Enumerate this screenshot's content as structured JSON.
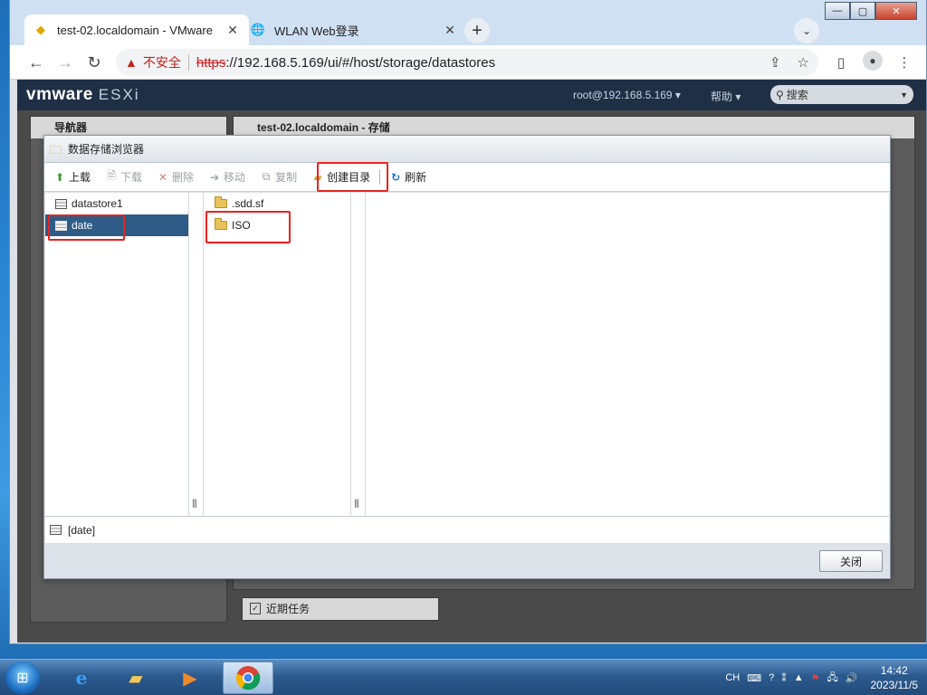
{
  "browser": {
    "tabs": [
      {
        "title": "test-02.localdomain - VMware",
        "active": true
      },
      {
        "title": "WLAN Web登录",
        "active": false
      }
    ],
    "address": {
      "insecure_label": "不安全",
      "scheme": "https",
      "rest": "://192.168.5.169/ui/#/host/storage/datastores"
    }
  },
  "esxi": {
    "logo_brand": "vmware",
    "logo_product": "ESXi",
    "user_menu": "root@192.168.5.169 ▾",
    "help_menu": "帮助 ▾",
    "search_placeholder": "搜索",
    "navigator_title": "导航器",
    "main_title": "test-02.localdomain - 存储",
    "tasks_title": "近期任务"
  },
  "dialog": {
    "title": "数据存储浏览器",
    "toolbar": {
      "upload": "上载",
      "download": "下载",
      "delete": "删除",
      "move": "移动",
      "copy": "复制",
      "create_dir": "创建目录",
      "refresh": "刷新"
    },
    "datastores": [
      "datastore1",
      "date"
    ],
    "selected_datastore": "date",
    "folders": [
      ".sdd.sf",
      "ISO"
    ],
    "status_path": "[date]",
    "close_label": "关闭"
  },
  "taskbar": {
    "lang": "CH",
    "time": "14:42",
    "date": "2023/11/5"
  },
  "colors": {
    "selection": "#2f5b87",
    "highlight": "#e8231f",
    "esxi_header": "#1f2f46"
  }
}
